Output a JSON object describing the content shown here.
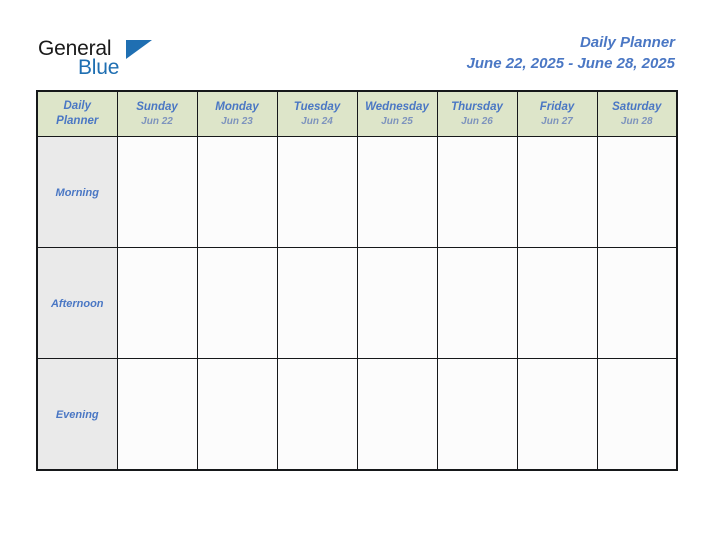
{
  "brand": {
    "name_part1": "General",
    "name_part2": "Blue",
    "triangle_icon": "brand-triangle-icon",
    "color_dark": "#1a1a1a",
    "color_blue": "#1f6fb2"
  },
  "header": {
    "title": "Daily Planner",
    "date_range": "June 22, 2025 - June 28, 2025",
    "title_color": "#4a77c4"
  },
  "table": {
    "corner": {
      "line1": "Daily",
      "line2": "Planner"
    },
    "header_background": "#dde5c9",
    "row_label_background": "#eaeaea",
    "cell_background": "#fcfcfc",
    "border_color": "#16181a",
    "columns": [
      {
        "day": "Sunday",
        "date": "Jun 22"
      },
      {
        "day": "Monday",
        "date": "Jun 23"
      },
      {
        "day": "Tuesday",
        "date": "Jun 24"
      },
      {
        "day": "Wednesday",
        "date": "Jun 25"
      },
      {
        "day": "Thursday",
        "date": "Jun 26"
      },
      {
        "day": "Friday",
        "date": "Jun 27"
      },
      {
        "day": "Saturday",
        "date": "Jun 28"
      }
    ],
    "rows": [
      {
        "label": "Morning",
        "entries": [
          "",
          "",
          "",
          "",
          "",
          "",
          ""
        ]
      },
      {
        "label": "Afternoon",
        "entries": [
          "",
          "",
          "",
          "",
          "",
          "",
          ""
        ]
      },
      {
        "label": "Evening",
        "entries": [
          "",
          "",
          "",
          "",
          "",
          "",
          ""
        ]
      }
    ]
  }
}
